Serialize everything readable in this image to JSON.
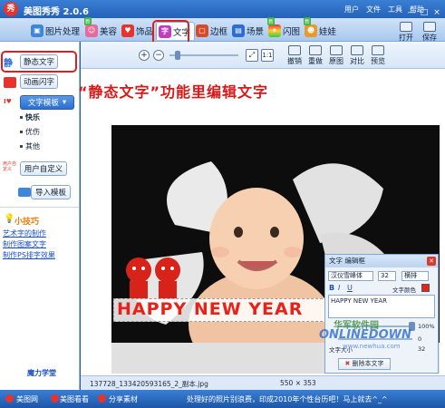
{
  "app": {
    "title": "美图秀秀 2.0.6",
    "logo": "秀"
  },
  "menu": [
    "用户",
    "文件",
    "工具",
    "帮助"
  ],
  "window_controls": [
    "—",
    "□",
    "×"
  ],
  "tabs": [
    {
      "label": "图片处理",
      "icon": "image-icon",
      "new": false
    },
    {
      "label": "美容",
      "icon": "face-icon",
      "new": true
    },
    {
      "label": "饰品",
      "icon": "heart-icon",
      "new": false
    },
    {
      "label": "文字",
      "icon": "text-icon",
      "new": false,
      "active": true
    },
    {
      "label": "边框",
      "icon": "frame-icon",
      "new": false
    },
    {
      "label": "场景",
      "icon": "scene-icon",
      "new": false
    },
    {
      "label": "闪图",
      "icon": "flash-icon",
      "new": true
    },
    {
      "label": "娃娃",
      "icon": "doll-icon",
      "new": true
    }
  ],
  "top_actions": {
    "open": "打开",
    "save": "保存"
  },
  "subtools": {
    "undo": "撤销",
    "reset": "重做",
    "original": "原图",
    "compare": "对比",
    "preview": "预览"
  },
  "sidebar": {
    "static_badge": "静",
    "static_text": "静态文字",
    "anim_text": "动画闪字",
    "template_label": "文字模板",
    "templates": [
      "快乐",
      "优伤",
      "其他"
    ],
    "custom_badge": "用户自定义",
    "custom": "用户自定义",
    "import": "导入模板",
    "tips_title": "小技巧",
    "tips": [
      "艺术字的制作",
      "制作图案文字",
      "制作PS排字效果"
    ],
    "bottom_link": "魔力学堂"
  },
  "annotation": "“静态文字”功能里编辑文字",
  "overlay_text": "HAPPY NEW YEAR",
  "dialog": {
    "title": "文字 编辑框",
    "font": "汉仪雪峰体",
    "size": "32",
    "direction": "横排",
    "bold": "B",
    "italic": "I",
    "underline": "U",
    "color_label": "文字颜色",
    "content": "HAPPY NEW YEAR",
    "opacity_value": "100%",
    "rotate_value": "0",
    "size_label": "文字大小",
    "size_value": "32",
    "delete_button": "删除本文字"
  },
  "watermark": {
    "cn": "华军软件园",
    "en": "ONLINEDOWN",
    "url": "www.newhua.com"
  },
  "status": {
    "filename": "137728_133420593165_2_副本.jpg",
    "dims": "550 × 353"
  },
  "bottom": {
    "items": [
      "美图网",
      "美图看看",
      "分享素材"
    ],
    "ticker": "处理好的照片别浪费，印成2010年个性台历吧！马上就去^_^"
  },
  "colors": {
    "accent": "#2462b8",
    "annotation_red": "#d91818",
    "text_red": "#e8221a"
  }
}
